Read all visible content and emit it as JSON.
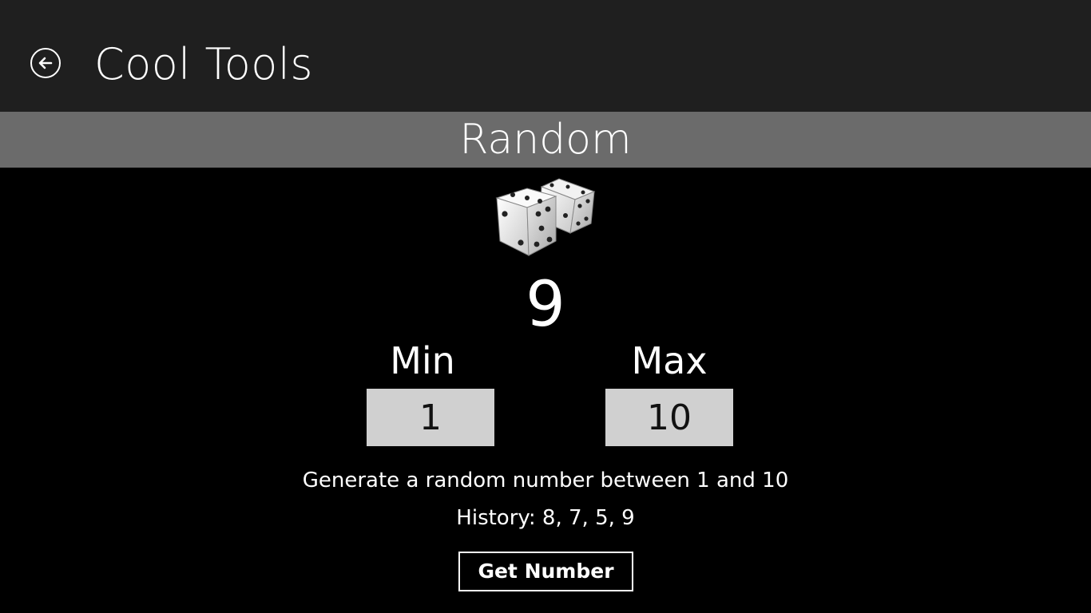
{
  "header": {
    "back_icon": "back-arrow-circle-icon",
    "title": "Cool Tools"
  },
  "section": {
    "title": "Random"
  },
  "dice_icon": "dice-icon",
  "result": {
    "value": "9"
  },
  "range": {
    "min_label": "Min",
    "min_value": "1",
    "max_label": "Max",
    "max_value": "10"
  },
  "description": "Generate a random number between 1 and 10",
  "history": "History: 8, 7, 5, 9",
  "actions": {
    "get_number_label": "Get Number"
  },
  "colors": {
    "header_bg": "#1f1f1f",
    "section_bar_bg": "#6b6b6b",
    "page_bg": "#000000",
    "input_bg": "#d0d0d0",
    "text": "#ffffff"
  }
}
